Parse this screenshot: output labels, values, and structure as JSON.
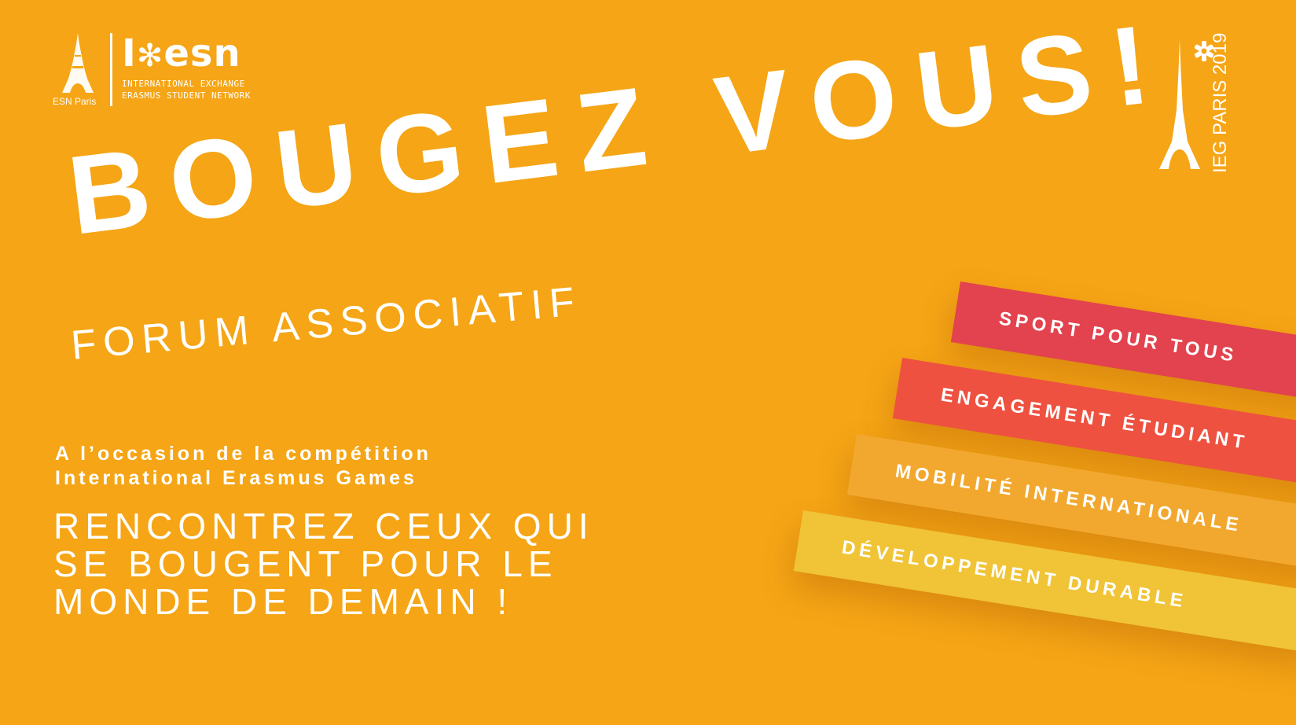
{
  "colors": {
    "background": "#F5A515",
    "text": "#FFFFFF",
    "ribbon_sport": "#E2434E",
    "ribbon_engagement": "#EE5140",
    "ribbon_mobilite": "#F2A82E",
    "ribbon_developpement": "#F0C436"
  },
  "esn_logo": {
    "city_label": "ESN Paris",
    "wordmark_prefix": "I",
    "wordmark_star": "✻",
    "wordmark_suffix": "esn",
    "subtitle_line1": "INTERNATIONAL EXCHANGE",
    "subtitle_line2": "ERASMUS STUDENT NETWORK"
  },
  "ieg_logo": {
    "text": "IEG PARIS 2019",
    "star_icon": "asterisk-icon"
  },
  "headline": {
    "title": "BOUGEZ VOUS!",
    "subtitle": "FORUM ASSOCIATIF"
  },
  "body": {
    "occasion_line1": "A l’occasion de la compétition",
    "occasion_line2": "International Erasmus Games",
    "tagline_line1": "RENCONTREZ CEUX QUI",
    "tagline_line2": "SE BOUGENT POUR LE",
    "tagline_line3": "MONDE DE DEMAIN !"
  },
  "themes": [
    "SPORT POUR TOUS",
    "ENGAGEMENT ÉTUDIANT",
    "MOBILITÉ INTERNATIONALE",
    "DÉVELOPPEMENT DURABLE"
  ]
}
